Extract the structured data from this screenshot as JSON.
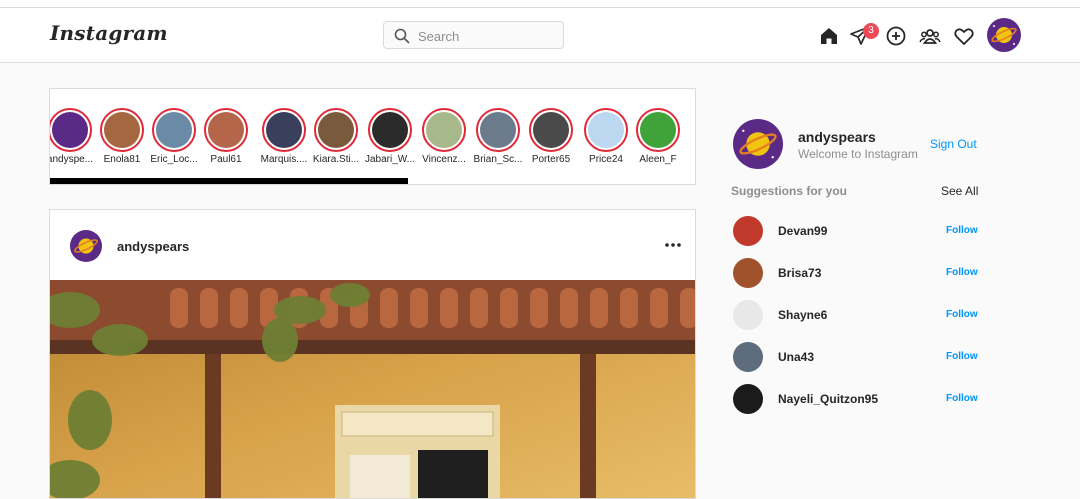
{
  "header": {
    "logo": "Instagram",
    "search": {
      "placeholder": "Search",
      "value": ""
    },
    "nav_icons": [
      "home-icon",
      "direct-message-icon",
      "new-post-icon",
      "people-icon",
      "heart-icon",
      "profile-avatar"
    ],
    "dm_badge": "3"
  },
  "stories": [
    {
      "name": "andyspe...",
      "color": "#5b2a86"
    },
    {
      "name": "Enola81",
      "color": "#a5673f"
    },
    {
      "name": "Eric_Loc...",
      "color": "#6b8aa5"
    },
    {
      "name": "Paul61",
      "color": "#b5654a"
    },
    {
      "name": "Marquis....",
      "color": "#3a3f5c"
    },
    {
      "name": "Kiara.Sti...",
      "color": "#7a5a3c"
    },
    {
      "name": "Jabari_W...",
      "color": "#2b2b2b"
    },
    {
      "name": "Vincenz...",
      "color": "#a7b98a"
    },
    {
      "name": "Brian_Sc...",
      "color": "#6c7b8b"
    },
    {
      "name": "Porter65",
      "color": "#4a4a4a"
    },
    {
      "name": "Price24",
      "color": "#bcd7f0"
    },
    {
      "name": "Aleen_F",
      "color": "#3fa33a"
    }
  ],
  "post": {
    "username": "andyspears",
    "more_icon": "more-dots-icon",
    "image_description_icon": "post-photo"
  },
  "sidebar": {
    "username": "andyspears",
    "subtitle": "Welcome to Instagram",
    "signout": "Sign Out",
    "suggestions_title": "Suggestions for you",
    "see_all": "See All",
    "suggestions": [
      {
        "name": "Devan99",
        "follow": "Follow",
        "color": "#c0392b"
      },
      {
        "name": "Brisa73",
        "follow": "Follow",
        "color": "#a0522d"
      },
      {
        "name": "Shayne6",
        "follow": "Follow",
        "color": "#e8e8e8"
      },
      {
        "name": "Una43",
        "follow": "Follow",
        "color": "#5d6d7e"
      },
      {
        "name": "Nayeli_Quitzon95",
        "follow": "Follow",
        "color": "#1b1b1b"
      }
    ]
  },
  "colors": {
    "accent": "#0095f6",
    "story_ring": "#e02a3a",
    "badge": "#ed4956",
    "avatar_purple": "#5b2a86"
  }
}
